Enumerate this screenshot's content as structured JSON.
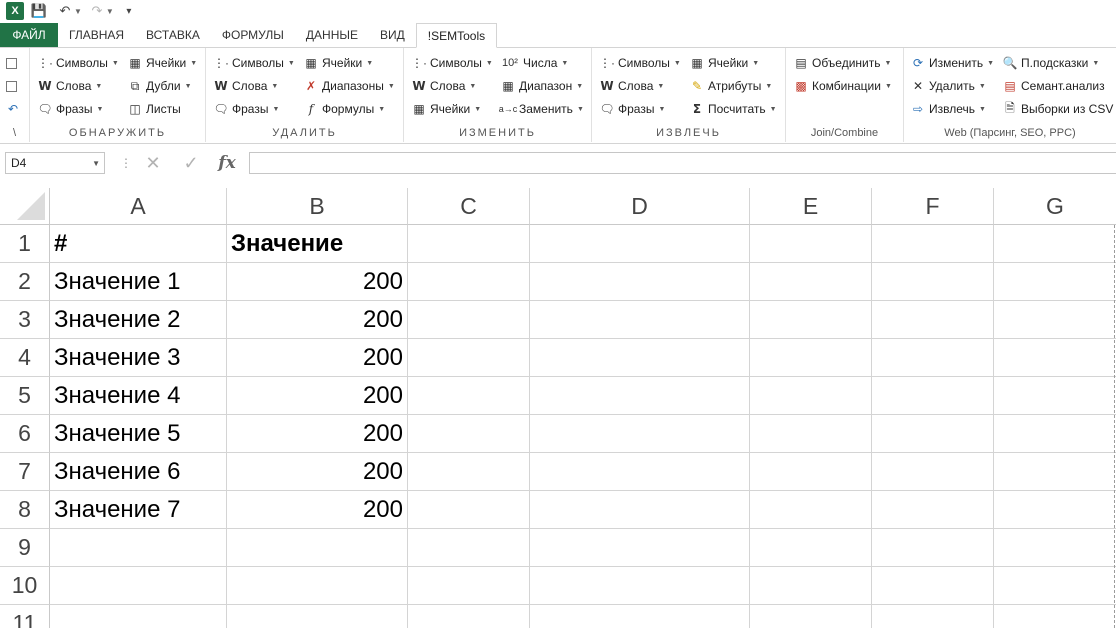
{
  "qat": {
    "app_icon": "excel-icon",
    "undo_icon": "undo-icon",
    "redo_icon": "redo-icon"
  },
  "tabs": [
    "ФАЙЛ",
    "ГЛАВНАЯ",
    "ВСТАВКА",
    "ФОРМУЛЫ",
    "ДАННЫЕ",
    "ВИД",
    "!SEMTools"
  ],
  "active_tab": "!SEMTools",
  "ribbon": {
    "groups": {
      "detect": "ОБНАРУЖИТЬ",
      "delete": "УДАЛИТЬ",
      "modify": "ИЗМЕНИТЬ",
      "extract": "ИЗВЛЕЧЬ",
      "join": "Join/Combine",
      "web": "Web (Парсинг, SEO, PPC)"
    },
    "left_undo_label": "\\",
    "detect": {
      "symbols": "Символы",
      "words": "Слова",
      "phrases": "Фразы",
      "cells": "Ячейки",
      "dupes": "Дубли",
      "sheets": "Листы"
    },
    "delete": {
      "symbols": "Символы",
      "words": "Слова",
      "phrases": "Фразы",
      "cells": "Ячейки",
      "ranges": "Диапазоны",
      "formulas": "Формулы"
    },
    "modify": {
      "symbols": "Символы",
      "words": "Слова",
      "cells": "Ячейки",
      "numbers": "Числа",
      "numbers_icon": "10²",
      "range": "Диапазон",
      "replace": "Заменить"
    },
    "extract": {
      "symbols": "Символы",
      "words": "Слова",
      "phrases": "Фразы",
      "cells": "Ячейки",
      "attributes": "Атрибуты",
      "count": "Посчитать"
    },
    "join": {
      "merge": "Объединить",
      "combos": "Комбинации"
    },
    "web": {
      "change": "Изменить",
      "delete": "Удалить",
      "extract": "Извлечь",
      "hints": "П.подсказки",
      "semantic": "Семант.анализ",
      "csv": "Выборки из CSV"
    }
  },
  "formula_bar": {
    "name_box": "D4",
    "formula": "",
    "fx_label": "fx"
  },
  "sheet": {
    "columns": [
      "A",
      "B",
      "C",
      "D",
      "E",
      "F",
      "G"
    ],
    "rows": [
      "1",
      "2",
      "3",
      "4",
      "5",
      "6",
      "7",
      "8",
      "9",
      "10",
      "11"
    ],
    "header": {
      "a": "#",
      "b": "Значение"
    },
    "data": [
      {
        "a": "Значение 1",
        "b": "200"
      },
      {
        "a": "Значение 2",
        "b": "200"
      },
      {
        "a": "Значение 3",
        "b": "200"
      },
      {
        "a": "Значение 4",
        "b": "200"
      },
      {
        "a": "Значение 5",
        "b": "200"
      },
      {
        "a": "Значение 6",
        "b": "200"
      },
      {
        "a": "Значение 7",
        "b": "200"
      }
    ]
  },
  "colors": {
    "file_tab": "#217346",
    "grid": "#d4d4d4"
  }
}
